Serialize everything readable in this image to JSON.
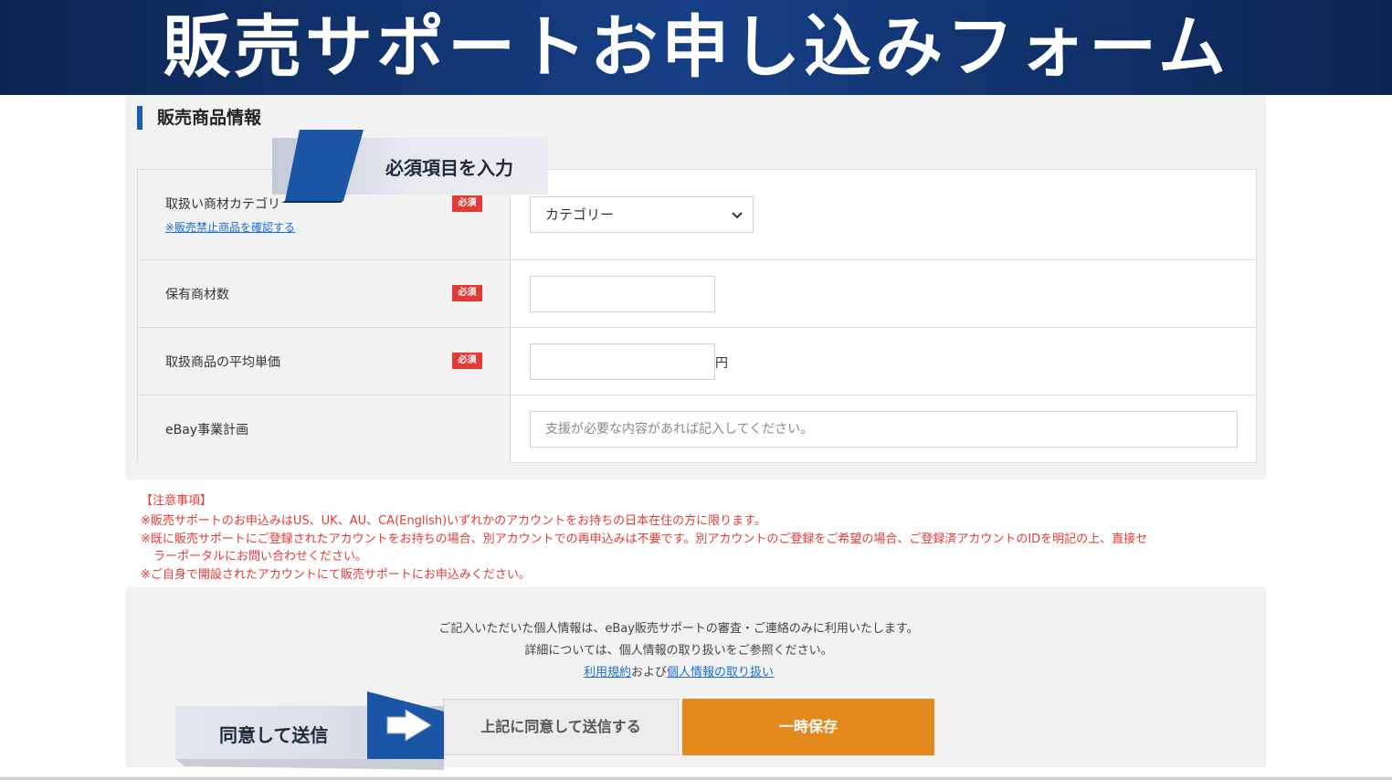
{
  "banner": {
    "title": "販売サポートお申し込みフォーム"
  },
  "section": {
    "title": "販売商品情報"
  },
  "callouts": {
    "required_input": "必須項目を入力",
    "agree_send": "同意して送信"
  },
  "form": {
    "rows": [
      {
        "label": "取扱い商材カテゴリ",
        "sublink": "※販売禁止商品を確認する",
        "badge": "必須",
        "select_value": "カテゴリー"
      },
      {
        "label": "保有商材数",
        "badge": "必須",
        "value": ""
      },
      {
        "label": "取扱商品の平均単価",
        "badge": "必須",
        "value": "",
        "unit": "円"
      },
      {
        "label": "eBay事業計画",
        "placeholder": "支援が必要な内容があれば記入してください。"
      }
    ]
  },
  "notes": [
    "【注意事項】",
    "※販売サポートのお申込みはUS、UK、AU、CA(English)いずれかのアカウントをお持ちの日本在住の方に限ります。",
    "※既に販売サポートにご登録されたアカウントをお持ちの場合、別アカウントでの再申込みは不要です。別アカウントのご登録をご希望の場合、ご登録済アカウントのIDを明記の上、直接セ",
    "ラーポータルにお問い合わせください。",
    "※ご自身で開設されたアカウントにて販売サポートにお申込みください。"
  ],
  "privacy": {
    "line1": "ご記入いただいた個人情報は、eBay販売サポートの審査・ご連絡のみに利用いたします。",
    "line2": "詳細については、個人情報の取り扱いをご参照ください。",
    "terms_link": "利用規約",
    "and_text": "および",
    "privacy_link": "個人情報の取り扱い"
  },
  "buttons": {
    "agree_label": "上記に同意して送信する",
    "save_label": "一時保存"
  },
  "colors": {
    "banner": "#0b2552",
    "accent_blue": "#1a5db7",
    "badge_red": "#e53935",
    "save_orange": "#e4891e",
    "link_blue": "#1a6fd0"
  }
}
